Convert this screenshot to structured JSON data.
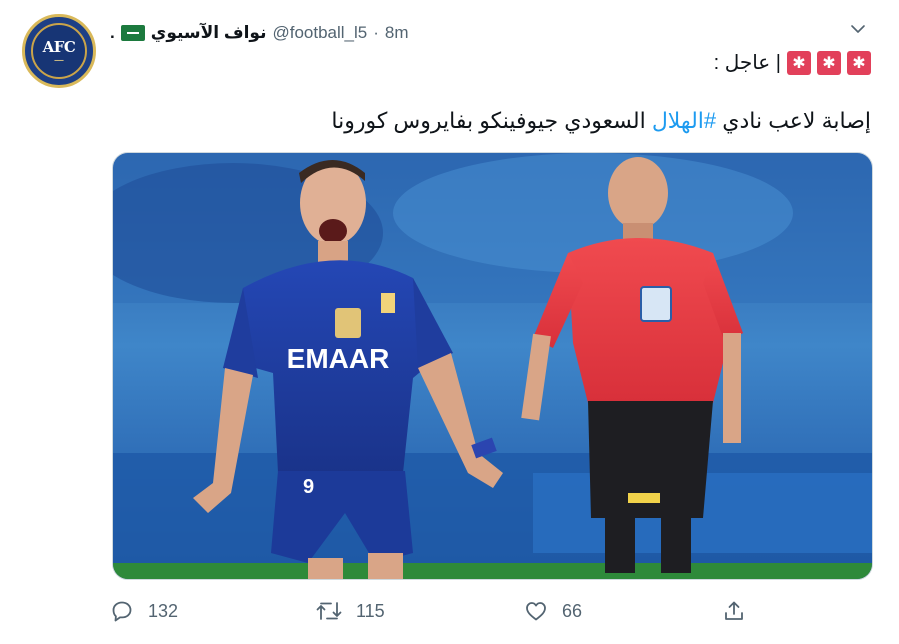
{
  "tweet": {
    "author_name": "نواف الآسيوي",
    "trailing_mark": ".",
    "handle": "@football_l5",
    "separator": "·",
    "time": "8m",
    "line1_text": "| عاجل :",
    "text_before": "إصابة لاعب نادي ",
    "hashtag": "#الهلال",
    "text_after": " السعودي جيوفينكو بفايروس كورونا"
  },
  "avatar": {
    "logo_text": "AFC"
  },
  "icons": {
    "flag": "saudi-flag-icon",
    "siren": "siren-icon",
    "caret": "chevron-down-icon"
  },
  "image": {
    "jersey_sponsor": "EMAAR",
    "shorts_number": "9"
  },
  "actions": {
    "replies": "132",
    "retweets": "115",
    "likes": "66"
  },
  "colors": {
    "hashtag": "#1d9bf0",
    "secondary_text": "#536471",
    "siren": "#e2405a",
    "hilal_blue": "#1f3d9e",
    "referee_red": "#e23a43"
  }
}
